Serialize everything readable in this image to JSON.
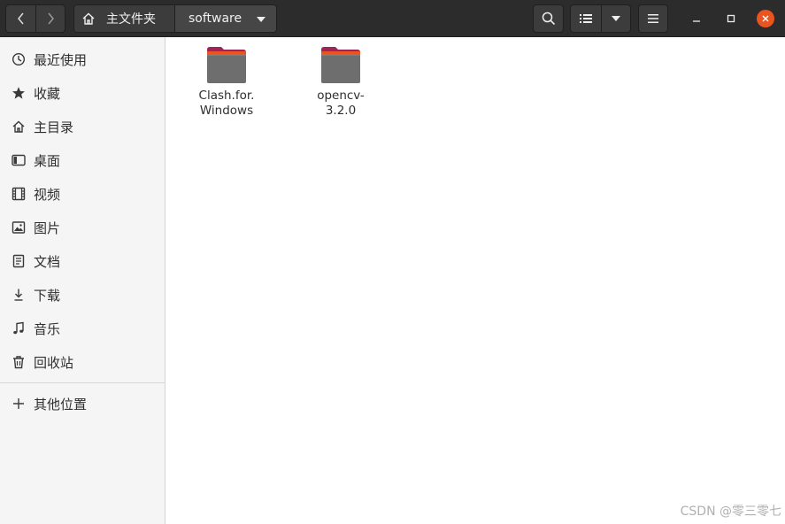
{
  "header": {
    "path": {
      "home_label": "主文件夹",
      "current_label": "software"
    },
    "icons": {
      "back": "chevron-left-icon",
      "forward": "chevron-right-icon",
      "home": "home-icon",
      "search": "search-icon",
      "list_view": "list-view-icon",
      "view_options": "triangle-down-icon",
      "menu": "hamburger-menu-icon",
      "minimize": "minimize-icon",
      "maximize": "maximize-icon",
      "close": "close-icon"
    },
    "colors": {
      "close_button": "#e95420",
      "headerbar": "#2c2c2c"
    }
  },
  "sidebar": {
    "items": [
      {
        "label": "最近使用",
        "icon": "clock-icon"
      },
      {
        "label": "收藏",
        "icon": "star-icon"
      },
      {
        "label": "主目录",
        "icon": "home-icon"
      },
      {
        "label": "桌面",
        "icon": "desktop-icon"
      },
      {
        "label": "视频",
        "icon": "film-icon"
      },
      {
        "label": "图片",
        "icon": "image-icon"
      },
      {
        "label": "文档",
        "icon": "document-icon"
      },
      {
        "label": "下载",
        "icon": "download-icon"
      },
      {
        "label": "音乐",
        "icon": "music-icon"
      },
      {
        "label": "回收站",
        "icon": "trash-icon"
      }
    ],
    "other": {
      "label": "其他位置",
      "icon": "plus-icon"
    }
  },
  "main": {
    "files": [
      {
        "name": "Clash.for.\nWindows",
        "line1": "Clash.for.",
        "line2": "Windows",
        "icon": "folder-icon"
      },
      {
        "name": "opencv-3.2.0",
        "line1": "opencv-",
        "line2": "3.2.0",
        "icon": "folder-icon"
      }
    ],
    "colors": {
      "folder_body": "#6e6e6e",
      "folder_tab": "#e95420",
      "folder_tab_accent": "#a0245a"
    }
  },
  "watermark": "CSDN @零三零七"
}
